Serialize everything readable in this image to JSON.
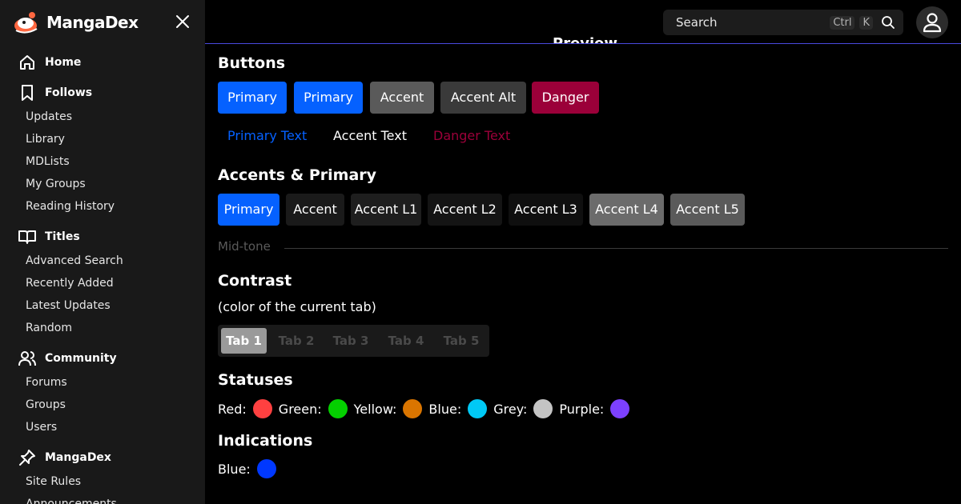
{
  "app": {
    "name": "MangaDex",
    "accent": "#0561ff"
  },
  "sidebar": {
    "sections": [
      {
        "label": "Home",
        "icon": "home-icon"
      },
      {
        "label": "Follows",
        "icon": "bookmark-icon",
        "items": [
          "Updates",
          "Library",
          "MDLists",
          "My Groups",
          "Reading History"
        ]
      },
      {
        "label": "Titles",
        "icon": "book-open-icon",
        "items": [
          "Advanced Search",
          "Recently Added",
          "Latest Updates",
          "Random"
        ]
      },
      {
        "label": "Community",
        "icon": "users-icon",
        "items": [
          "Forums",
          "Groups",
          "Users"
        ]
      },
      {
        "label": "MangaDex",
        "icon": "pin-icon",
        "items": [
          "Site Rules",
          "Announcements"
        ]
      }
    ]
  },
  "header": {
    "search_placeholder": "Search",
    "shortcut_ctrl": "Ctrl",
    "shortcut_key": "K",
    "preview_title": "Preview"
  },
  "buttons_section": {
    "title": "Buttons",
    "buttons": [
      {
        "label": "Primary",
        "color": "#0561ff"
      },
      {
        "label": "Primary",
        "color": "#0561ff"
      },
      {
        "label": "Accent",
        "color": "#5a5a5a"
      },
      {
        "label": "Accent Alt",
        "color": "#3a3a3a"
      },
      {
        "label": "Danger",
        "color": "#9b0039"
      }
    ],
    "text_buttons": [
      {
        "label": "Primary Text",
        "color": "#0561ff"
      },
      {
        "label": "Accent Text",
        "color": "#ffffff"
      },
      {
        "label": "Danger Text",
        "color": "#9b0039"
      }
    ]
  },
  "accents_section": {
    "title": "Accents & Primary",
    "swatches": [
      {
        "label": "Primary",
        "color": "#0561ff"
      },
      {
        "label": "Accent",
        "color": "#1a1a1a"
      },
      {
        "label": "Accent L1",
        "color": "#1e1e1e"
      },
      {
        "label": "Accent L2",
        "color": "#141414"
      },
      {
        "label": "Accent L3",
        "color": "#0f0f0f"
      },
      {
        "label": "Accent L4",
        "color": "#6b6b6b"
      },
      {
        "label": "Accent L5",
        "color": "#5a5a5a"
      }
    ],
    "midtone_label": "Mid-tone"
  },
  "contrast_section": {
    "title": "Contrast",
    "note": "(color of the current tab)",
    "tabs": [
      "Tab 1",
      "Tab 2",
      "Tab 3",
      "Tab 4",
      "Tab 5"
    ],
    "active_tab": 0
  },
  "statuses_section": {
    "title": "Statuses",
    "items": [
      {
        "label": "Red:",
        "color": "#ff4040"
      },
      {
        "label": "Green:",
        "color": "#04d000"
      },
      {
        "label": "Yellow:",
        "color": "#da7500"
      },
      {
        "label": "Blue:",
        "color": "#00c9f5"
      },
      {
        "label": "Grey:",
        "color": "#c4c4c4"
      },
      {
        "label": "Purple:",
        "color": "#7c40ff"
      }
    ]
  },
  "indications_section": {
    "title": "Indications",
    "items": [
      {
        "label": "Blue:",
        "color": "#0038ff"
      }
    ]
  }
}
